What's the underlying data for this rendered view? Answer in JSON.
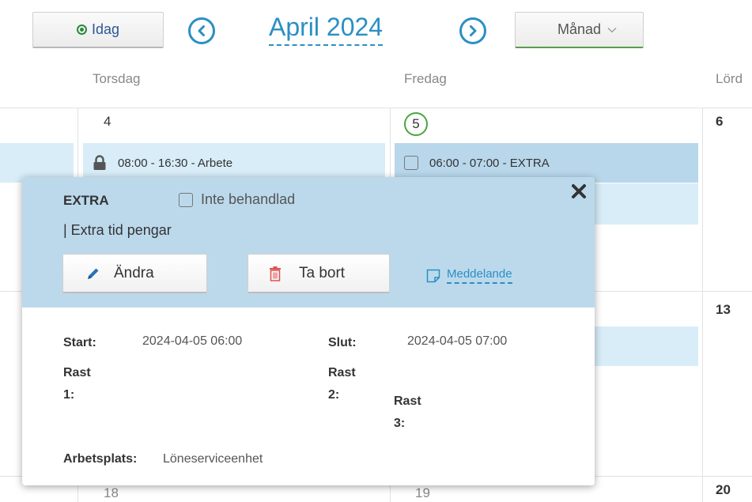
{
  "toolbar": {
    "today_label": "Idag",
    "month_title": "April 2024",
    "view_label": "Månad"
  },
  "calendar": {
    "day_headers": [
      "Torsdag",
      "Fredag",
      "Lörd"
    ],
    "dates": {
      "thu_w1": "4",
      "fri_w1": "5",
      "sat_w1": "6",
      "sat_w2": "13",
      "thu_w3": "18",
      "fri_w3": "19",
      "sat_w3": "20"
    },
    "events": {
      "thu_event": "08:00 - 16:30 - Arbete",
      "fri_event": "06:00 - 07:00 - EXTRA"
    }
  },
  "popup": {
    "type": "EXTRA",
    "status": "Inte behandlad",
    "description": "| Extra tid pengar",
    "edit_label": "Ändra",
    "delete_label": "Ta bort",
    "message_label": "Meddelande",
    "start_label": "Start:",
    "start_value": "2024-04-05  06:00",
    "end_label": "Slut:",
    "end_value": "2024-04-05  07:00",
    "break1_label_a": "Rast",
    "break1_label_b": "1:",
    "break2_label_a": "Rast",
    "break2_label_b": "2:",
    "break3_label_a": "Rast",
    "break3_label_b": "3:",
    "workplace_label": "Arbetsplats:",
    "workplace_value": "Löneserviceenhet"
  },
  "colors": {
    "accent": "#2a8fc4",
    "today_green": "#4aa63f",
    "popup_header": "#bcd9ec",
    "event_light": "#d8edf8",
    "event_dark": "#b9d7eb"
  }
}
